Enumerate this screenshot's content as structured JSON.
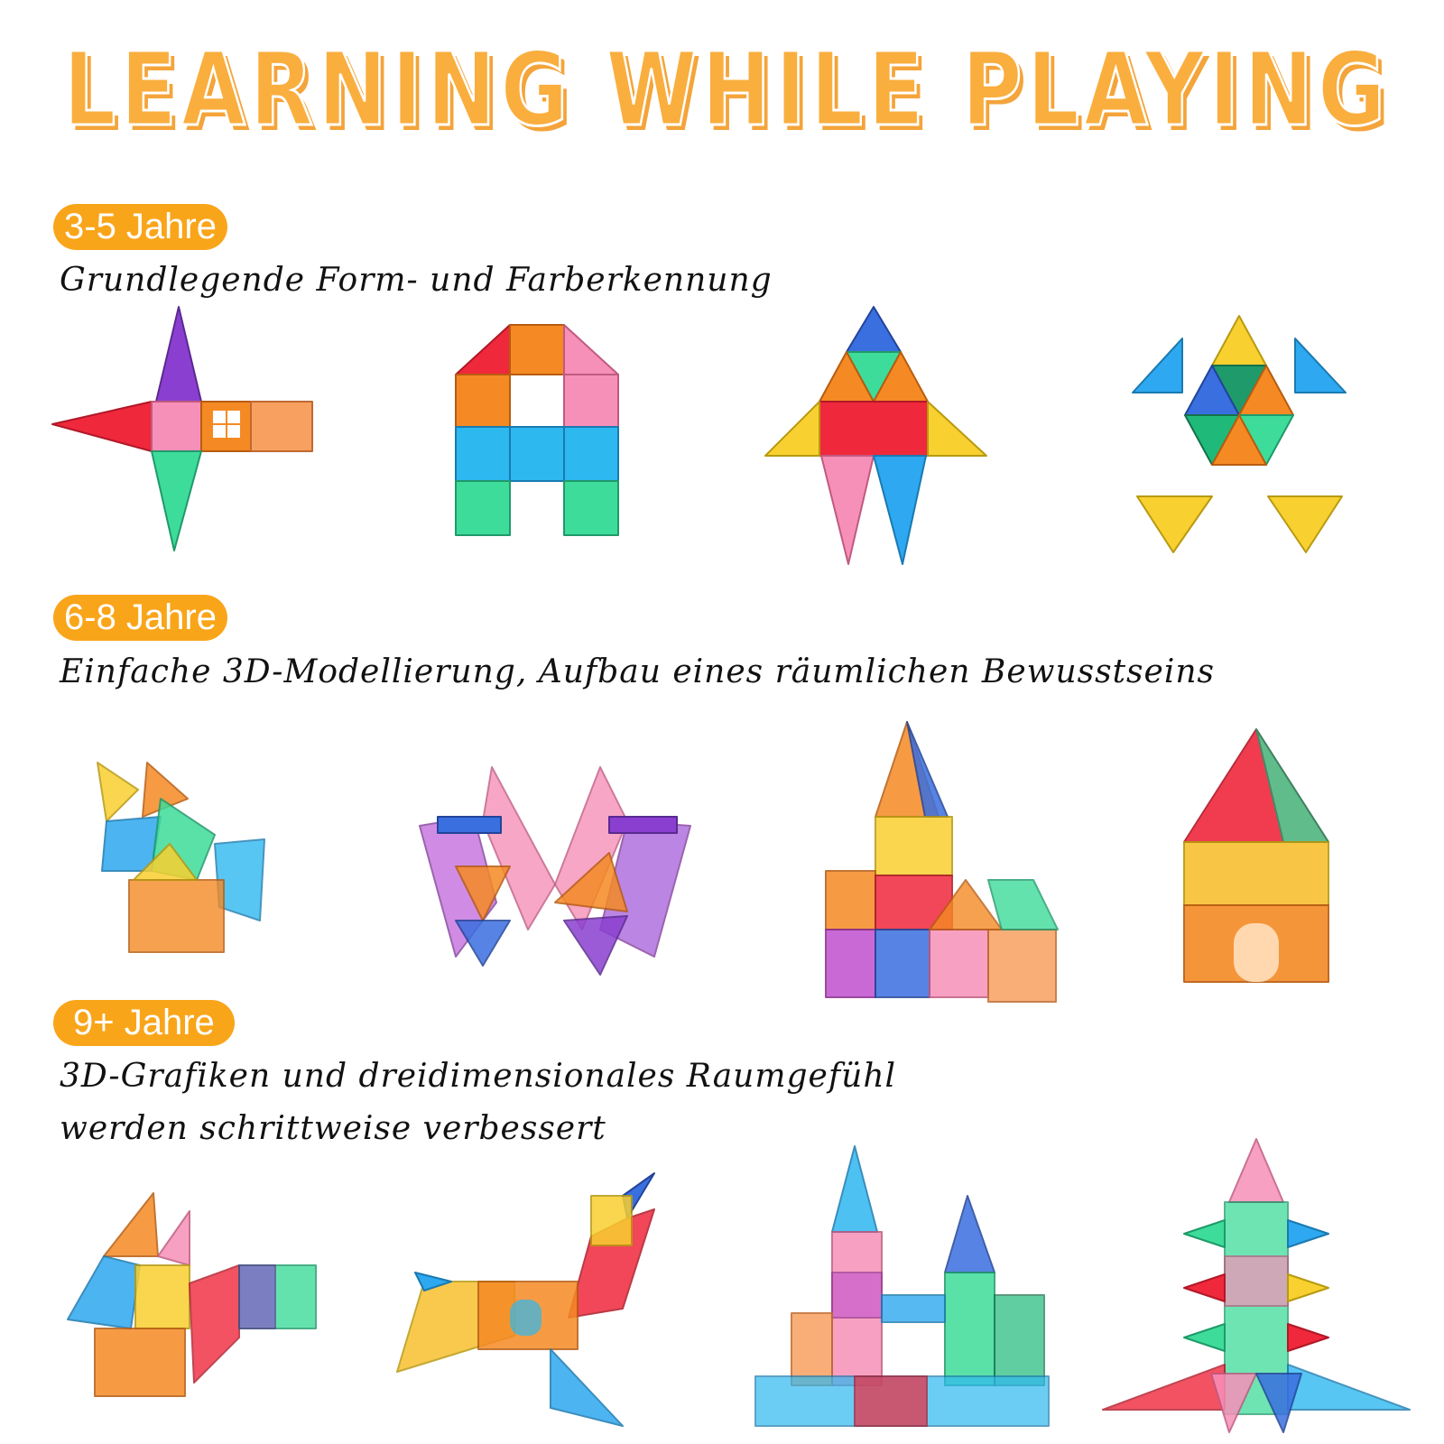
{
  "title": "LEARNING WHILE PLAYING",
  "accent_color": "#F9A51A",
  "title_color": "#F9AE3E",
  "sections": [
    {
      "badge": "3-5 Jahre",
      "description": "Grundlegende Form- und Farberkennung",
      "models": [
        "star-rocket",
        "letter-a",
        "triangle-rocket",
        "turtle"
      ]
    },
    {
      "badge": "6-8 Jahre",
      "description": "Einfache 3D-Modellierung, Aufbau eines räumlichen Bewusstseins",
      "models": [
        "fox",
        "butterfly",
        "castle-tower",
        "hexagonal-tower"
      ]
    },
    {
      "badge": "9+ Jahre",
      "description_lines": [
        "3D-Grafiken und dreidimensionales Raumgefühl",
        "werden schrittweise verbessert"
      ],
      "models": [
        "animal-cubes",
        "airplane",
        "castle",
        "rocket-tree"
      ]
    }
  ]
}
